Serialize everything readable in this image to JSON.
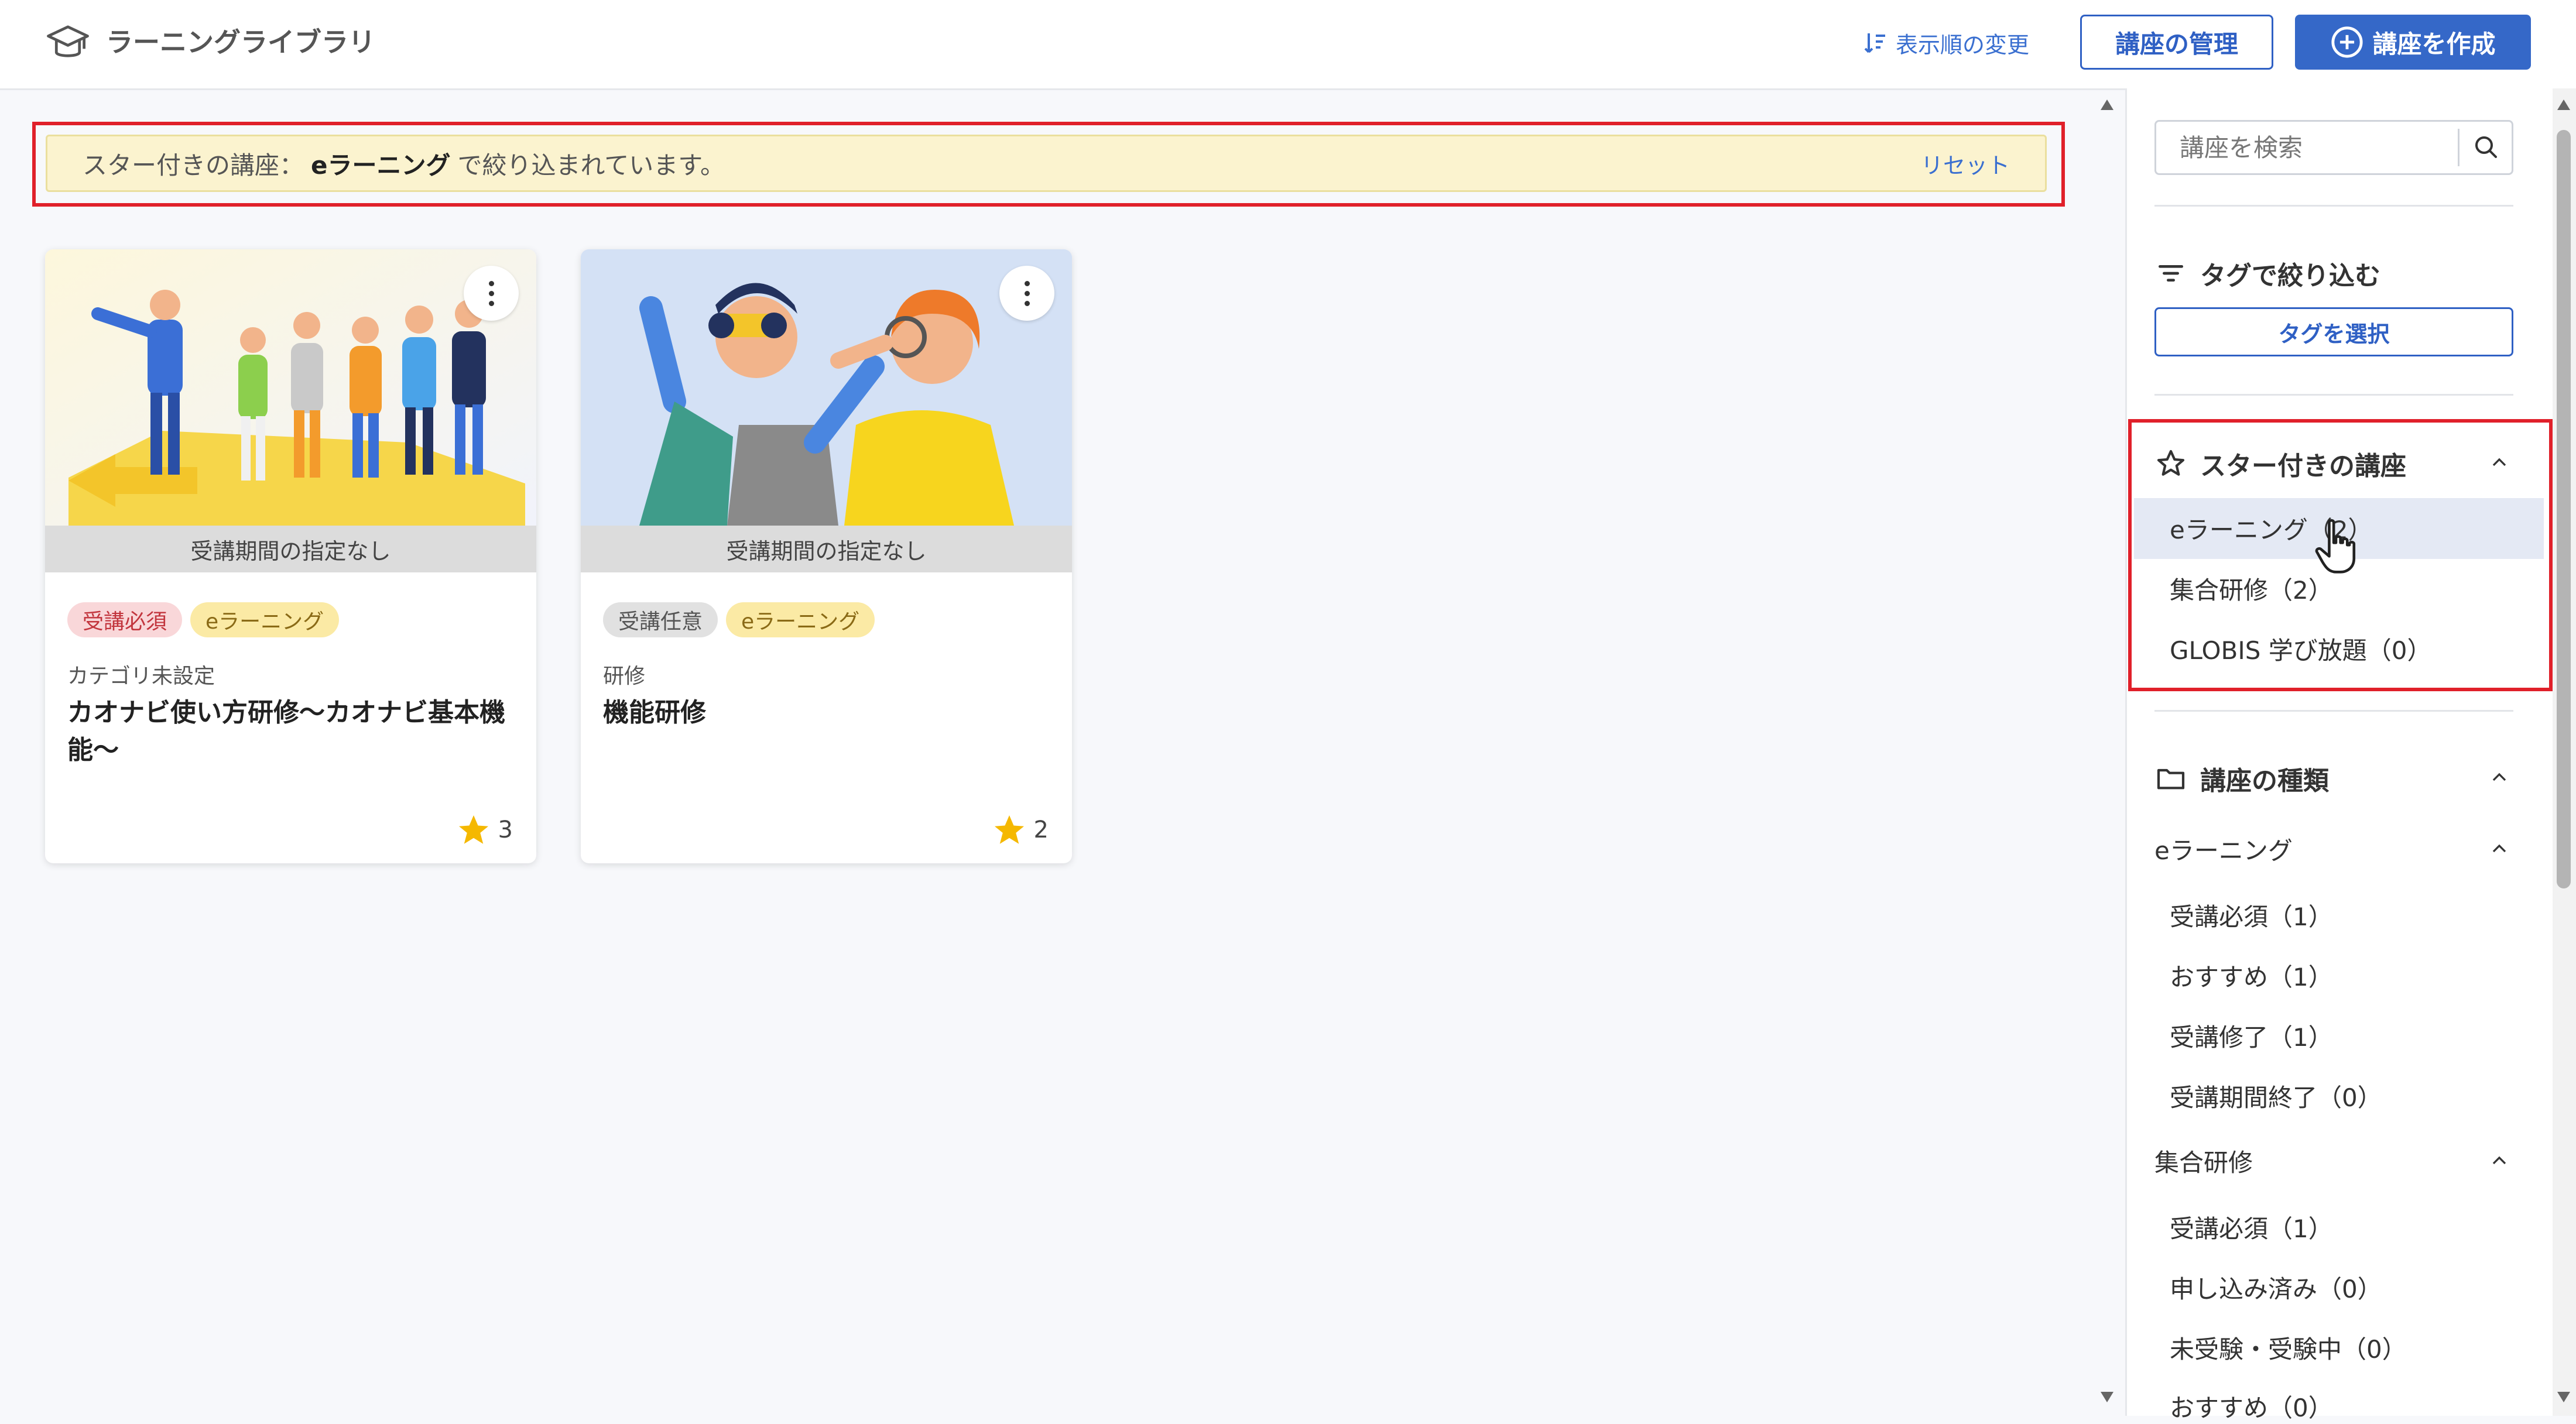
{
  "header": {
    "app_title": "ラーニングライブラリ",
    "sort_label": "表示順の変更",
    "manage_label": "講座の管理",
    "create_label": "講座を作成"
  },
  "filter_banner": {
    "prefix": "スター付きの講座：",
    "value": "eラーニング",
    "suffix": "で絞り込まれています。",
    "reset_label": "リセット"
  },
  "cards": [
    {
      "period": "受講期間の指定なし",
      "tags": [
        "受講必須",
        "eラーニング"
      ],
      "category": "カテゴリ未設定",
      "title": "カオナビ使い方研修〜カオナビ基本機能〜",
      "stars": "3"
    },
    {
      "period": "受講期間の指定なし",
      "tags": [
        "受講任意",
        "eラーニング"
      ],
      "category": "研修",
      "title": "機能研修",
      "stars": "2"
    }
  ],
  "sidebar": {
    "search_placeholder": "講座を検索",
    "tag_filter_heading": "タグで絞り込む",
    "tag_select_label": "タグを選択",
    "starred_heading": "スター付きの講座",
    "starred_items": [
      "eラーニング（2）",
      "集合研修（2）",
      "GLOBIS 学び放題（0）"
    ],
    "types_heading": "講座の種類",
    "elearning_heading": "eラーニング",
    "elearning_items": [
      "受講必須（1）",
      "おすすめ（1）",
      "受講修了（1）",
      "受講期間終了（0）"
    ],
    "group_heading": "集合研修",
    "group_items": [
      "受講必須（1）",
      "申し込み済み（0）",
      "未受験・受験中（0）",
      "おすすめ（0）"
    ]
  },
  "colors": {
    "accent": "#3568c8",
    "highlight_border": "#e0202a",
    "banner_bg": "#fbf3cf",
    "star": "#f5b800"
  }
}
